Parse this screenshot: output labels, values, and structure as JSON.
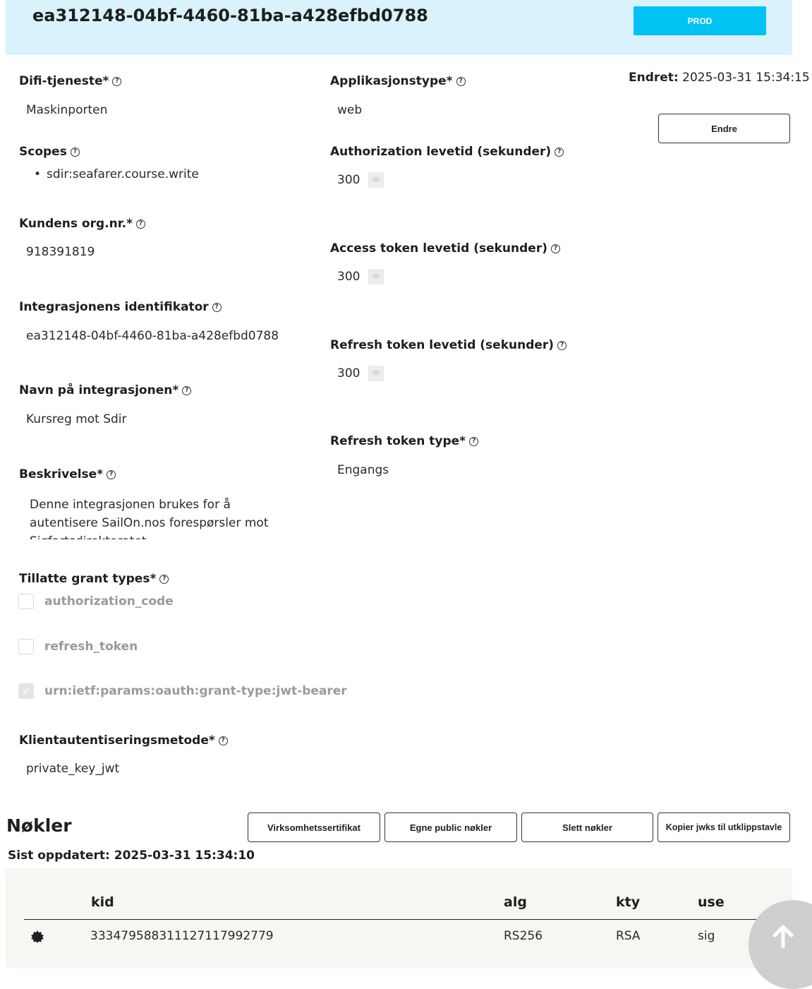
{
  "header": {
    "client_id": "ea312148-04bf-4460-81ba-a428efbd0788",
    "environment_label": "PROD"
  },
  "meta": {
    "changed_label": "Endret:",
    "changed_value": "2025-03-31 15:34:15",
    "edit_button": "Endre"
  },
  "left": {
    "difi_service": {
      "label": "Difi-tjeneste*",
      "value": "Maskinporten"
    },
    "scopes": {
      "label": "Scopes",
      "items": [
        "sdir:seafarer.course.write"
      ]
    },
    "org_nr": {
      "label": "Kundens org.nr.*",
      "value": "918391819"
    },
    "integration_id": {
      "label": "Integrasjonens identifikator",
      "value": "ea312148-04bf-4460-81ba-a428efbd0788"
    },
    "integration_name": {
      "label": "Navn på integrasjonen*",
      "value": "Kursreg mot Sdir"
    },
    "description": {
      "label": "Beskrivelse*",
      "value": "Denne integrasjonen brukes for å autentisere SailOn.nos forespørsler mot Sjøfartsdirektoratet"
    },
    "grant_types": {
      "label": "Tillatte grant types*",
      "items": [
        {
          "label": "authorization_code",
          "checked": false
        },
        {
          "label": "refresh_token",
          "checked": false
        },
        {
          "label": "urn:ietf:params:oauth:grant-type:jwt-bearer",
          "checked": true
        }
      ]
    },
    "client_auth_method": {
      "label": "Klientautentiseringsmetode*",
      "value": "private_key_jwt"
    }
  },
  "right": {
    "app_type": {
      "label": "Applikasjonstype*",
      "value": "web"
    },
    "authorization_lifetime": {
      "label": "Authorization levetid (sekunder)",
      "value": "300"
    },
    "access_token_lifetime": {
      "label": "Access token levetid (sekunder)",
      "value": "300"
    },
    "refresh_token_lifetime": {
      "label": "Refresh token levetid (sekunder)",
      "value": "300"
    },
    "refresh_token_type": {
      "label": "Refresh token type*",
      "value": "Engangs"
    }
  },
  "keys": {
    "title": "Nøkler",
    "buttons": [
      "Virksomhetssertifikat",
      "Egne public nøkler",
      "Slett nøkler",
      "Kopier jwks til utklippstavle"
    ],
    "updated": "Sist oppdatert: 2025-03-31 15:34:10",
    "columns": [
      "kid",
      "alg",
      "kty",
      "use"
    ],
    "rows": [
      {
        "kid": "333479588311127117992779",
        "alg": "RS256",
        "kty": "RSA",
        "use": "sig"
      }
    ]
  },
  "icons": {
    "help": "question-circle-icon",
    "key_row": "badge-icon",
    "scroll_top": "arrow-up-icon"
  },
  "colors": {
    "header_bg": "#d9f2fc",
    "accent": "#00c2f3",
    "table_bg": "#f8f6f2"
  }
}
